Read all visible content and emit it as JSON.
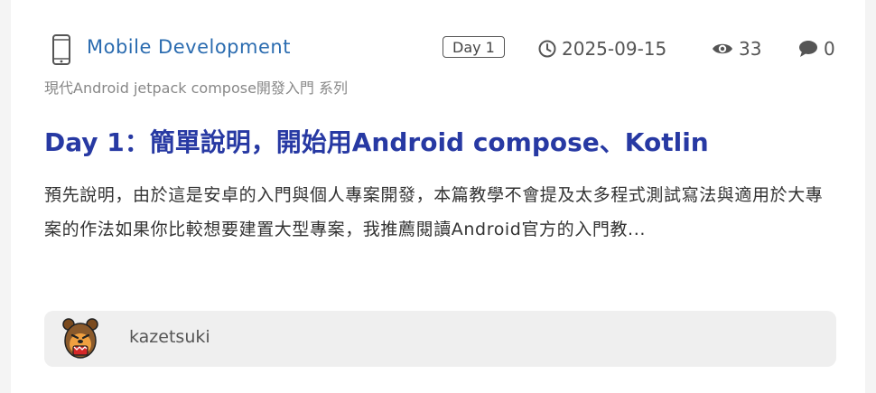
{
  "post": {
    "category": "Mobile Development",
    "category_icon": "mobile-phone-icon",
    "day_badge": "Day 1",
    "date": "2025-09-15",
    "views": "33",
    "comments": "0",
    "series": "現代Android jetpack compose開發入門 系列",
    "title": "Day 1：簡單說明，開始用Android compose、Kotlin",
    "excerpt": "預先說明，由於這是安卓的入門與個人專案開發，本篇教學不會提及太多程式測試寫法與適用於大專案的作法如果你比較想要建置大型專案，我推薦閱讀Android官方的入門教...",
    "author": "kazetsuki"
  },
  "colors": {
    "category": "#2b6cb0",
    "title": "#2739a3",
    "meta": "#555555",
    "author_bar": "#efefef"
  }
}
